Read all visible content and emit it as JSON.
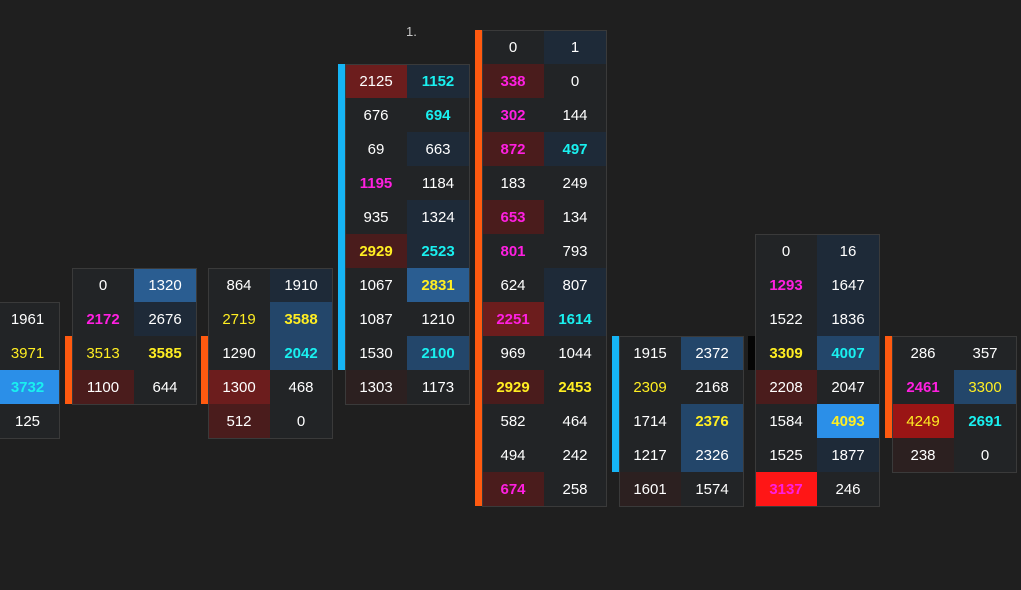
{
  "chart_data": {
    "type": "table",
    "label": "1.",
    "colors": {
      "background": "#1f1f1f",
      "text_default": "#ffffff",
      "text_magenta": "#ff1fe0",
      "text_cyan": "#19f0f0",
      "text_yellow": "#ffee22",
      "bar_orange": "#ff5a10",
      "bar_blue": "#16b4f4",
      "bar_black": "#050505"
    },
    "columns": [
      {
        "bar": {
          "row_start": 2,
          "row_end": 2,
          "color": "black"
        },
        "rows": [
          [
            [
              "1961",
              "n",
              "n"
            ]
          ],
          [
            [
              "3971",
              "y",
              "n"
            ]
          ],
          [
            [
              "3732",
              "c",
              "bb"
            ]
          ],
          [
            [
              "125",
              "n",
              "n"
            ]
          ]
        ],
        "row_offset": 0,
        "cells": 1,
        "clip_left": true
      },
      {
        "rows": [
          [
            [
              "0",
              "n",
              "n"
            ],
            [
              "1320",
              "n",
              "b3"
            ]
          ],
          [
            [
              "2172",
              "m",
              "n"
            ],
            [
              "2676",
              "n",
              "b1"
            ]
          ],
          [
            [
              "3513",
              "y",
              "n"
            ],
            [
              "3585",
              "y",
              "n"
            ]
          ],
          [
            [
              "1100",
              "n",
              "r1"
            ],
            [
              "644",
              "n",
              "n"
            ]
          ]
        ],
        "bar": {
          "row_start": 2,
          "row_end": 3,
          "color": "orange"
        }
      },
      {
        "rows": [
          [
            [
              "864",
              "n",
              "n"
            ],
            [
              "1910",
              "n",
              "b1"
            ]
          ],
          [
            [
              "2719",
              "y",
              "n"
            ],
            [
              "3588",
              "y",
              "b2"
            ]
          ],
          [
            [
              "1290",
              "n",
              "n"
            ],
            [
              "2042",
              "c",
              "b2"
            ]
          ],
          [
            [
              "1300",
              "n",
              "r2"
            ],
            [
              "468",
              "n",
              "n"
            ]
          ],
          [
            [
              "512",
              "n",
              "r1"
            ],
            [
              "0",
              "n",
              "n"
            ]
          ]
        ],
        "bar": {
          "row_start": 2,
          "row_end": 3,
          "color": "orange"
        }
      },
      {
        "rows": [
          [
            [
              "2125",
              "n",
              "r2"
            ],
            [
              "1152",
              "c",
              "b1"
            ]
          ],
          [
            [
              "676",
              "n",
              "n"
            ],
            [
              "694",
              "c",
              "n"
            ]
          ],
          [
            [
              "69",
              "n",
              "n"
            ],
            [
              "663",
              "n",
              "b1"
            ]
          ],
          [
            [
              "1195",
              "m",
              "n"
            ],
            [
              "1184",
              "n",
              "n"
            ]
          ],
          [
            [
              "935",
              "n",
              "n"
            ],
            [
              "1324",
              "n",
              "b1"
            ]
          ],
          [
            [
              "2929",
              "y",
              "r1"
            ],
            [
              "2523",
              "c",
              "b1"
            ]
          ],
          [
            [
              "1067",
              "n",
              "n"
            ],
            [
              "2831",
              "y",
              "b3"
            ]
          ],
          [
            [
              "1087",
              "n",
              "n"
            ],
            [
              "1210",
              "n",
              "n"
            ]
          ],
          [
            [
              "1530",
              "n",
              "n"
            ],
            [
              "2100",
              "c",
              "b2"
            ]
          ],
          [
            [
              "1303",
              "n",
              "r0"
            ],
            [
              "1173",
              "n",
              "n"
            ]
          ]
        ],
        "bar": {
          "row_start": 0,
          "row_end": 8,
          "color": "blue"
        }
      },
      {
        "rows": [
          [
            [
              "0",
              "n",
              "n"
            ],
            [
              "1",
              "n",
              "b1"
            ]
          ],
          [
            [
              "338",
              "m",
              "r1"
            ],
            [
              "0",
              "n",
              "n"
            ]
          ],
          [
            [
              "302",
              "m",
              "n"
            ],
            [
              "144",
              "n",
              "n"
            ]
          ],
          [
            [
              "872",
              "m",
              "r1"
            ],
            [
              "497",
              "c",
              "b1"
            ]
          ],
          [
            [
              "183",
              "n",
              "n"
            ],
            [
              "249",
              "n",
              "n"
            ]
          ],
          [
            [
              "653",
              "m",
              "r1"
            ],
            [
              "134",
              "n",
              "n"
            ]
          ],
          [
            [
              "801",
              "m",
              "n"
            ],
            [
              "793",
              "n",
              "n"
            ]
          ],
          [
            [
              "624",
              "n",
              "n"
            ],
            [
              "807",
              "n",
              "b1"
            ]
          ],
          [
            [
              "2251",
              "m",
              "r2"
            ],
            [
              "1614",
              "c",
              "b1"
            ]
          ],
          [
            [
              "969",
              "n",
              "n"
            ],
            [
              "1044",
              "n",
              "n"
            ]
          ],
          [
            [
              "2929",
              "y",
              "r1"
            ],
            [
              "2453",
              "y",
              "n"
            ]
          ],
          [
            [
              "582",
              "n",
              "n"
            ],
            [
              "464",
              "n",
              "n"
            ]
          ],
          [
            [
              "494",
              "n",
              "n"
            ],
            [
              "242",
              "n",
              "n"
            ]
          ],
          [
            [
              "674",
              "m",
              "r1"
            ],
            [
              "258",
              "n",
              "n"
            ]
          ]
        ],
        "bar": {
          "row_start": 0,
          "row_end": 13,
          "color": "orange"
        }
      },
      {
        "rows": [
          [
            [
              "1915",
              "n",
              "n"
            ],
            [
              "2372",
              "n",
              "b2"
            ]
          ],
          [
            [
              "2309",
              "y",
              "n"
            ],
            [
              "2168",
              "n",
              "n"
            ]
          ],
          [
            [
              "1714",
              "n",
              "n"
            ],
            [
              "2376",
              "y",
              "b2"
            ]
          ],
          [
            [
              "1217",
              "n",
              "n"
            ],
            [
              "2326",
              "n",
              "b2"
            ]
          ],
          [
            [
              "1601",
              "n",
              "r0"
            ],
            [
              "1574",
              "n",
              "n"
            ]
          ]
        ],
        "bar": {
          "row_start": 0,
          "row_end": 3,
          "color": "blue"
        }
      },
      {
        "rows": [
          [
            [
              "0",
              "n",
              "n"
            ],
            [
              "16",
              "n",
              "b1"
            ]
          ],
          [
            [
              "1293",
              "m",
              "n"
            ],
            [
              "1647",
              "n",
              "b1"
            ]
          ],
          [
            [
              "1522",
              "n",
              "n"
            ],
            [
              "1836",
              "n",
              "b1"
            ]
          ],
          [
            [
              "3309",
              "y",
              "n"
            ],
            [
              "4007",
              "c",
              "b2"
            ]
          ],
          [
            [
              "2208",
              "n",
              "r1"
            ],
            [
              "2047",
              "n",
              "n"
            ]
          ],
          [
            [
              "1584",
              "n",
              "n"
            ],
            [
              "4093",
              "y",
              "bb"
            ]
          ],
          [
            [
              "1525",
              "n",
              "n"
            ],
            [
              "1877",
              "n",
              "b1"
            ]
          ],
          [
            [
              "3137",
              "m",
              "rr"
            ],
            [
              "246",
              "n",
              "n"
            ]
          ]
        ],
        "bar": {
          "row_start": 3,
          "row_end": 3,
          "color": "black"
        }
      },
      {
        "rows": [
          [
            [
              "286",
              "n",
              "n"
            ],
            [
              "357",
              "n",
              "n"
            ]
          ],
          [
            [
              "2461",
              "m",
              "n"
            ],
            [
              "3300",
              "y",
              "b2"
            ]
          ],
          [
            [
              "4249",
              "y",
              "r3"
            ],
            [
              "2691",
              "c",
              "n"
            ]
          ],
          [
            [
              "238",
              "n",
              "r0"
            ],
            [
              "0",
              "n",
              "n"
            ]
          ]
        ],
        "bar": {
          "row_start": 0,
          "row_end": 2,
          "color": "orange"
        }
      }
    ]
  }
}
